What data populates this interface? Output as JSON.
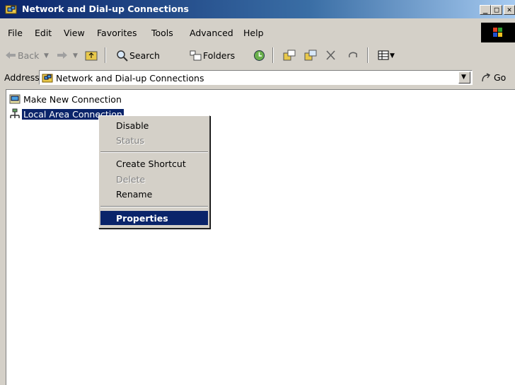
{
  "window": {
    "title": "Network and Dial-up Connections",
    "minimize": "_",
    "maximize": "□",
    "close": "✕"
  },
  "menu": [
    "File",
    "Edit",
    "View",
    "Favorites",
    "Tools",
    "Advanced",
    "Help"
  ],
  "toolbar": {
    "back": "Back",
    "search": "Search",
    "folders": "Folders"
  },
  "address": {
    "label": "Address",
    "value": "Network and Dial-up Connections",
    "go": "Go"
  },
  "items": [
    {
      "label": "Make New Connection",
      "icon": "make-connection-icon"
    },
    {
      "label": "Local Area Connection",
      "icon": "lan-connection-icon"
    }
  ],
  "context_menu": {
    "disable": "Disable",
    "status": "Status",
    "create_shortcut": "Create Shortcut",
    "delete": "Delete",
    "rename": "Rename",
    "properties": "Properties"
  },
  "colors": {
    "titlebar": "#0a246a",
    "selection": "#0a246a",
    "face": "#d4d0c8"
  }
}
